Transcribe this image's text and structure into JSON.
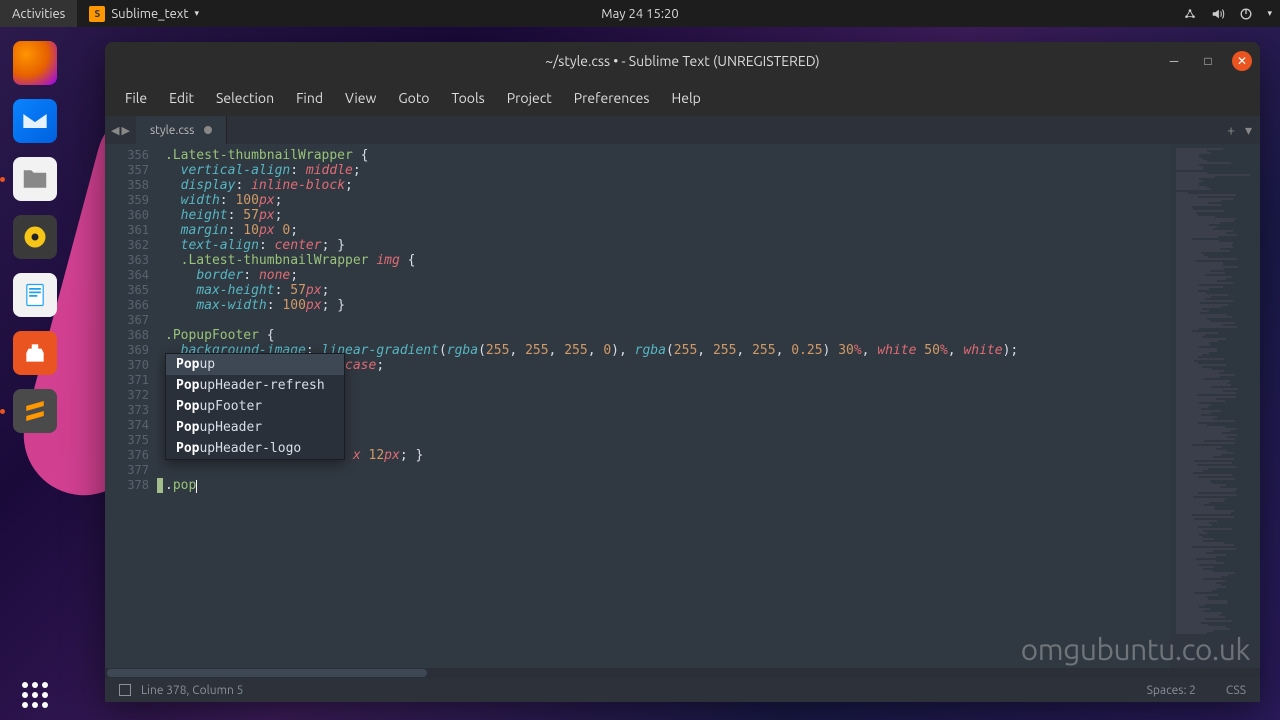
{
  "topbar": {
    "activities": "Activities",
    "app": "Sublime_text",
    "datetime": "May 24  15:20"
  },
  "window": {
    "title": "~/style.css • - Sublime Text (UNREGISTERED)"
  },
  "menubar": [
    "File",
    "Edit",
    "Selection",
    "Find",
    "View",
    "Goto",
    "Tools",
    "Project",
    "Preferences",
    "Help"
  ],
  "tab": {
    "name": "style.css"
  },
  "gutter": [
    "356",
    "357",
    "358",
    "359",
    "360",
    "361",
    "362",
    "363",
    "364",
    "365",
    "366",
    "367",
    "368",
    "369",
    "370",
    "371",
    "372",
    "373",
    "374",
    "375",
    "376",
    "377",
    "378"
  ],
  "code": {
    "l378": ".pop"
  },
  "autocomplete": {
    "items": [
      {
        "pre": "Pop",
        "rest": "up"
      },
      {
        "pre": "Pop",
        "rest": "upHeader-refresh"
      },
      {
        "pre": "Pop",
        "rest": "upFooter"
      },
      {
        "pre": "Pop",
        "rest": "upHeader"
      },
      {
        "pre": "Pop",
        "rest": "upHeader-logo"
      }
    ]
  },
  "statusbar": {
    "position": "Line 378, Column 5",
    "spaces": "Spaces: 2",
    "syntax": "CSS"
  },
  "watermark": "omgubuntu.co.uk"
}
